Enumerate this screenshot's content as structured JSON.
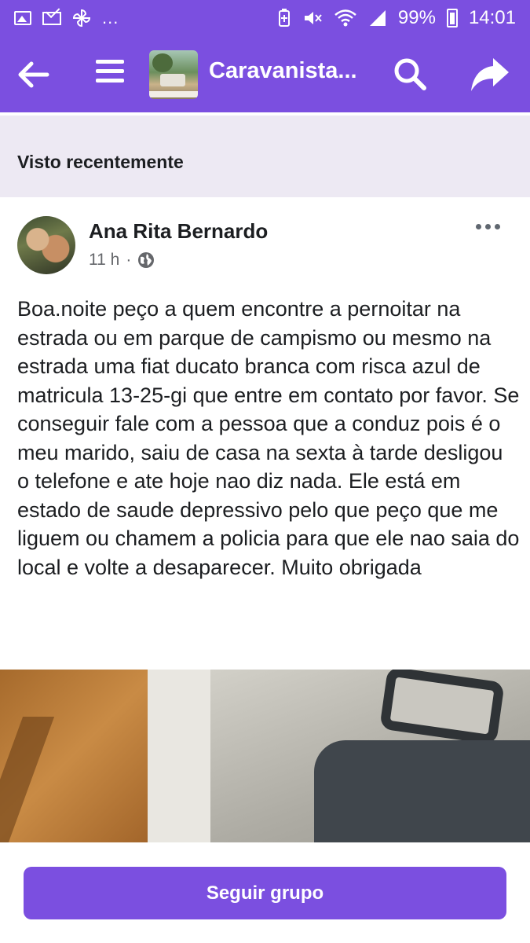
{
  "status_bar": {
    "more_notifications": "...",
    "battery": "99%",
    "time": "14:01"
  },
  "app_bar": {
    "group_name": "Caravanista..."
  },
  "recent": {
    "label": "Visto recentemente"
  },
  "post": {
    "author": "Ana Rita Bernardo",
    "time": "11 h",
    "separator": "·",
    "privacy_icon": "globe-icon",
    "body": "Boa.noite peço a quem encontre a pernoitar na estrada ou em parque de campismo ou mesmo na estrada uma fiat ducato branca com risca azul de matricula 13-25-gi que entre em contato por favor. Se conseguir fale com a pessoa que a conduz pois é o meu marido, saiu de casa na sexta à tarde desligou o telefone e ate hoje nao diz nada. Ele está em estado de saude depressivo pelo que peço que me liguem ou chamem a policia para que ele nao saia do local e volte a desaparecer. Muito obrigada"
  },
  "bottom": {
    "follow_label": "Seguir grupo"
  },
  "colors": {
    "brand": "#7b4fe0",
    "band": "#ede9f3"
  }
}
